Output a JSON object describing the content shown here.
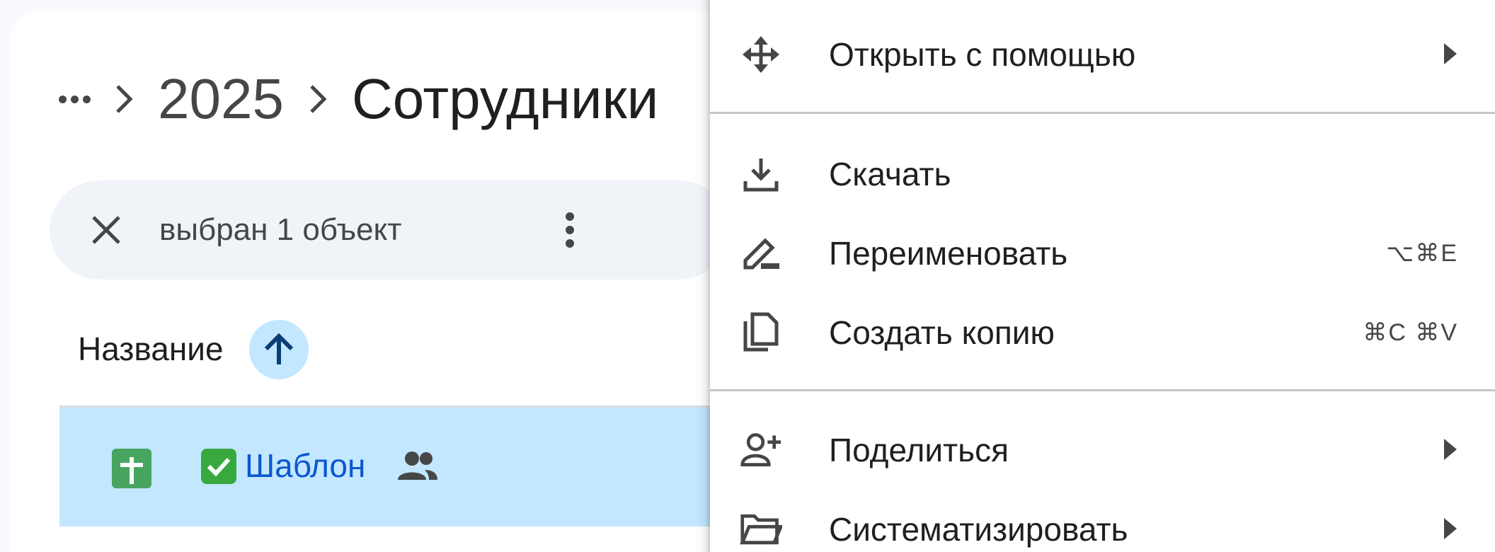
{
  "breadcrumb": {
    "more_label": "",
    "items": [
      "2025"
    ],
    "current": "Сотрудники"
  },
  "selection": {
    "count_text": "выбран 1 объект"
  },
  "list": {
    "column_name": "Название",
    "rows": [
      {
        "prefix_emoji": "✅",
        "name": "Шаблон"
      }
    ]
  },
  "menu": {
    "items": [
      {
        "label": "Открыть с помощью",
        "icon": "open-with-icon",
        "submenu": true
      },
      {
        "label": "Скачать",
        "icon": "download-icon"
      },
      {
        "label": "Переименовать",
        "icon": "rename-icon",
        "shortcut": "⌥⌘E"
      },
      {
        "label": "Создать копию",
        "icon": "copy-icon",
        "shortcut": "⌘C ⌘V"
      },
      {
        "label": "Поделиться",
        "icon": "share-person-add-icon",
        "submenu": true
      },
      {
        "label": "Систематизировать",
        "icon": "folder-icon",
        "submenu": true
      }
    ]
  },
  "colors": {
    "accent": "#0b57d0",
    "selected_row": "#c2e7ff",
    "sheets_green": "#47a560"
  }
}
